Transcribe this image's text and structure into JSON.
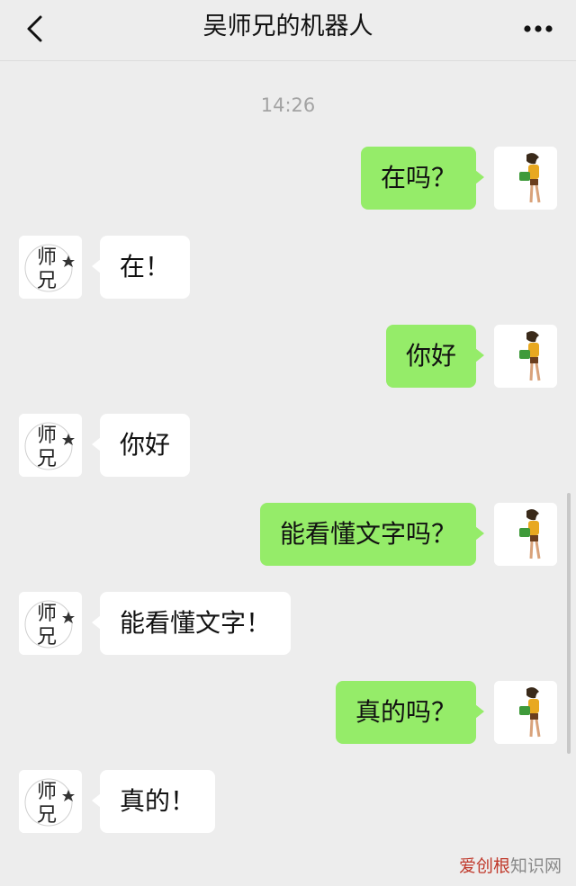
{
  "header": {
    "title": "吴师兄的机器人",
    "back_icon": "chevron-left-icon",
    "more_icon": "more-horizontal-icon"
  },
  "timestamp": "14:26",
  "messages": [
    {
      "from": "me",
      "text": "在吗？"
    },
    {
      "from": "bot",
      "text": "在！"
    },
    {
      "from": "me",
      "text": "你好"
    },
    {
      "from": "bot",
      "text": "你好"
    },
    {
      "from": "me",
      "text": "能看懂文字吗？"
    },
    {
      "from": "bot",
      "text": "能看懂文字！"
    },
    {
      "from": "me",
      "text": "真的吗？"
    },
    {
      "from": "bot",
      "text": "真的！"
    }
  ],
  "bot_avatar": {
    "line1": "师",
    "line2": "兄"
  },
  "watermark": {
    "brand": "爱创根",
    "rest": "知识网"
  },
  "colors": {
    "background": "#ededed",
    "outgoing_bubble": "#95ec69",
    "incoming_bubble": "#ffffff"
  }
}
